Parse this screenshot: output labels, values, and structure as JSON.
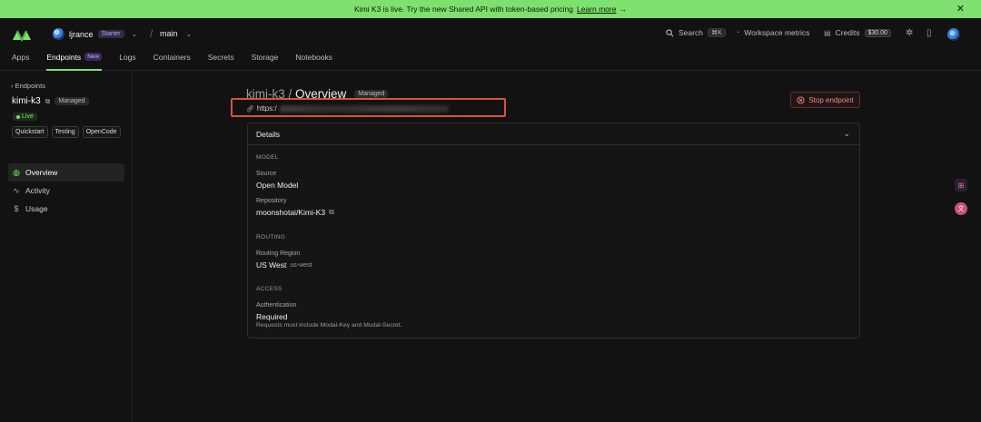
{
  "banner": {
    "text": "Kimi K3 is live. Try the new Shared API with token-based pricing",
    "link": "Learn more",
    "arrow": "→",
    "close": "✕"
  },
  "workspace": {
    "name": "ljrance",
    "plan": "Starter",
    "separator": "/",
    "branch": "main"
  },
  "topbar": {
    "search_label": "Search",
    "search_kbd": "⌘K",
    "metrics_label": "Workspace metrics",
    "credits_label": "Credits",
    "credits_value": "$30.00"
  },
  "tabs": [
    {
      "label": "Apps"
    },
    {
      "label": "Endpoints",
      "badge": "New",
      "active": true
    },
    {
      "label": "Logs"
    },
    {
      "label": "Containers"
    },
    {
      "label": "Secrets"
    },
    {
      "label": "Storage"
    },
    {
      "label": "Notebooks"
    }
  ],
  "sidebar": {
    "back": "‹ Endpoints",
    "title": "kimi-k3",
    "managed": "Managed",
    "status": "Live",
    "chips": [
      "Quickstart",
      "Testing",
      "OpenCode"
    ],
    "nav": [
      {
        "label": "Overview",
        "icon": "globe-icon",
        "active": true
      },
      {
        "label": "Activity",
        "icon": "activity-icon"
      },
      {
        "label": "Usage",
        "icon": "dollar-icon"
      }
    ]
  },
  "main": {
    "title_prefix": "kimi-k3 / ",
    "title": "Overview",
    "badge": "Managed",
    "url_prefix": "https:/",
    "stop_label": "Stop endpoint",
    "details": {
      "heading": "Details",
      "model_section": "MODEL",
      "source_label": "Source",
      "source_value": "Open Model",
      "repo_label": "Repository",
      "repo_value": "moonshotai/Kimi-K3",
      "routing_section": "ROUTING",
      "region_label": "Routing Region",
      "region_value": "US West",
      "region_sub": "us-west",
      "access_section": "ACCESS",
      "auth_label": "Authentication",
      "auth_value": "Required",
      "auth_note": "Requests must include Modal-Key and Modal-Secret."
    }
  },
  "colors": {
    "accent": "#7ee06e",
    "danger": "#f08a8a",
    "highlight": "#d9533a"
  }
}
